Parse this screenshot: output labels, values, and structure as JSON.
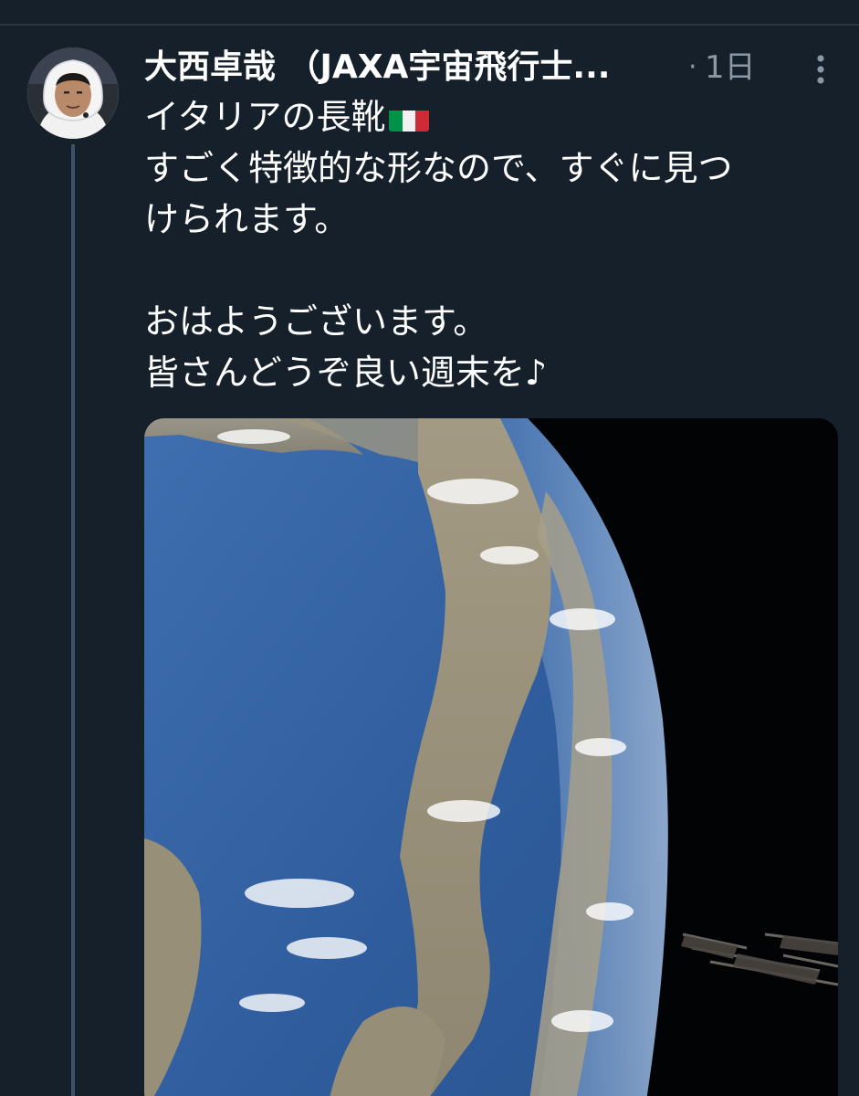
{
  "tweet": {
    "author": {
      "display_name": "大西卓哉 （JAXA宇宙飛行士...",
      "avatar_icon": "astronaut-avatar"
    },
    "separator": "·",
    "timestamp": "1日",
    "more_icon": "more-dots-icon",
    "text": {
      "line1": "イタリアの長靴",
      "line1_emoji": "italy-flag-icon",
      "line2": "すごく特徴的な形なので、すぐに見つ",
      "line3": "けられます。",
      "line4": "",
      "line5": "おはようございます。",
      "line6": "皆さんどうぞ良い週末を♪"
    },
    "media": {
      "type": "photo",
      "subject": "earth-from-space-italy-photo"
    }
  },
  "colors": {
    "background": "#15202b",
    "text_primary": "#ffffff",
    "text_secondary": "#8b98a5",
    "thread_line": "#3d5466"
  }
}
